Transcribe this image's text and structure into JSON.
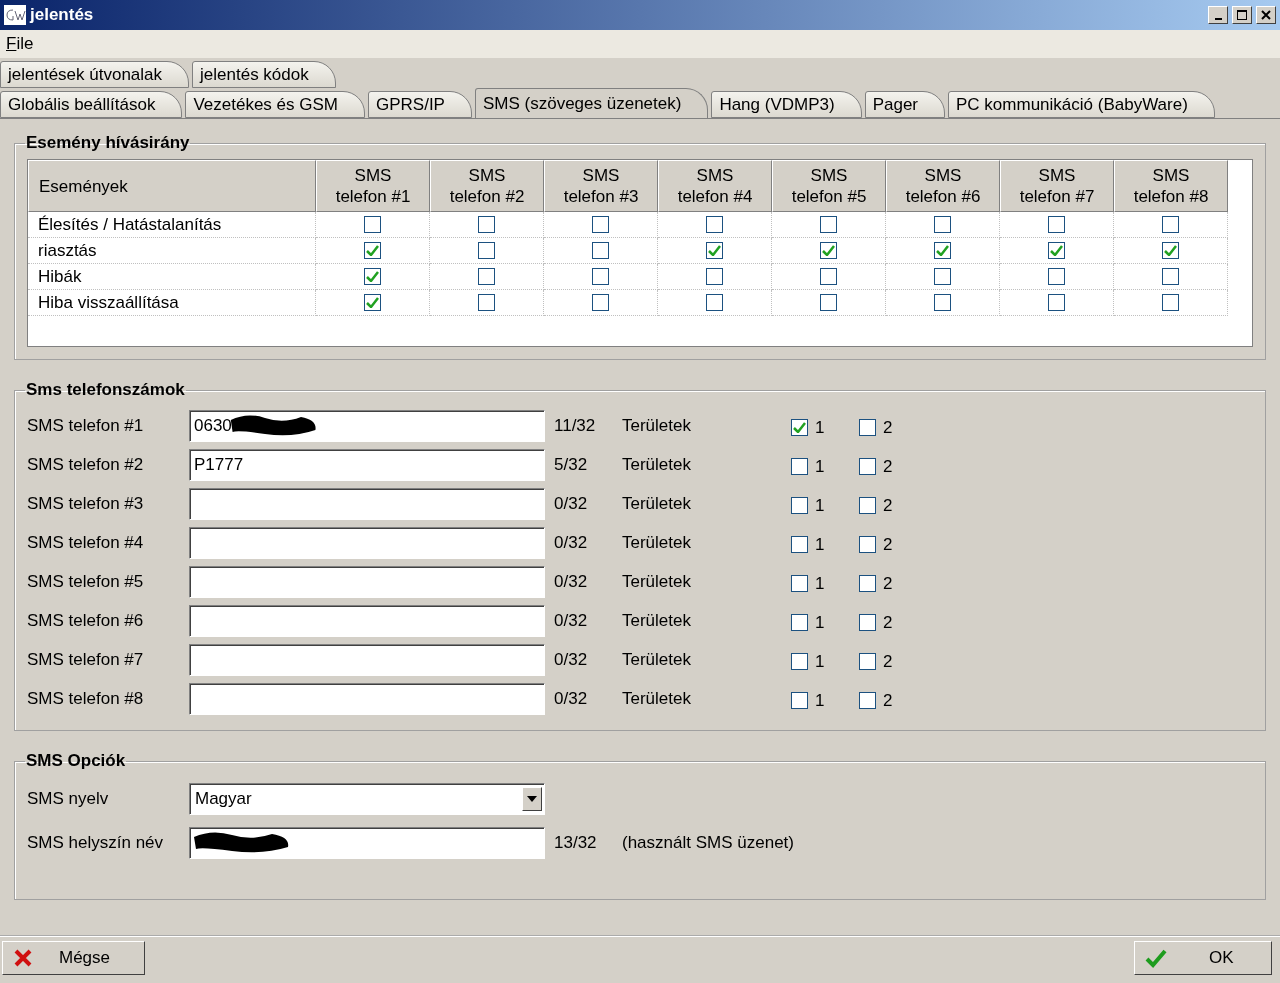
{
  "window": {
    "title": "jelentés"
  },
  "menu": [
    {
      "label": "File"
    }
  ],
  "tab_rows": [
    [
      {
        "label": "jelentések útvonalak",
        "selected": false
      },
      {
        "label": "jelentés kódok",
        "selected": false
      }
    ],
    [
      {
        "label": "Globális beállítások",
        "selected": false
      },
      {
        "label": "Vezetékes és GSM",
        "selected": false
      },
      {
        "label": "GPRS/IP",
        "selected": false
      },
      {
        "label": "SMS (szöveges üzenetek)",
        "selected": true
      },
      {
        "label": "Hang (VDMP3)",
        "selected": false
      },
      {
        "label": "Pager",
        "selected": false
      },
      {
        "label": "PC kommunikáció (BabyWare)",
        "selected": false
      }
    ]
  ],
  "event_routing": {
    "title": "Esemény hívásirány",
    "first_column": "Események",
    "columns": [
      [
        "SMS",
        "telefon #1"
      ],
      [
        "SMS",
        "telefon #2"
      ],
      [
        "SMS",
        "telefon #3"
      ],
      [
        "SMS",
        "telefon #4"
      ],
      [
        "SMS",
        "telefon #5"
      ],
      [
        "SMS",
        "telefon #6"
      ],
      [
        "SMS",
        "telefon #7"
      ],
      [
        "SMS",
        "telefon #8"
      ]
    ],
    "rows": [
      {
        "event": "Élesítés / Hatástalanítás",
        "checked": [
          false,
          false,
          false,
          false,
          false,
          false,
          false,
          false
        ]
      },
      {
        "event": "riasztás",
        "checked": [
          true,
          false,
          false,
          true,
          true,
          true,
          true,
          true
        ]
      },
      {
        "event": "Hibák",
        "checked": [
          true,
          false,
          false,
          false,
          false,
          false,
          false,
          false
        ]
      },
      {
        "event": "Hiba visszaállítása",
        "checked": [
          true,
          false,
          false,
          false,
          false,
          false,
          false,
          false
        ]
      }
    ]
  },
  "phones": {
    "title": "Sms telefonszámok",
    "items": [
      {
        "label": "SMS telefon #1",
        "value": "0630",
        "redacted": true,
        "count": "11/32",
        "areas_label": "Területek",
        "areas": [
          {
            "label": "1",
            "checked": true
          },
          {
            "label": "2",
            "checked": false
          }
        ]
      },
      {
        "label": "SMS telefon #2",
        "value": "P1777",
        "redacted": false,
        "count": "5/32",
        "areas_label": "Területek",
        "areas": [
          {
            "label": "1",
            "checked": false
          },
          {
            "label": "2",
            "checked": false
          }
        ]
      },
      {
        "label": "SMS telefon #3",
        "redacted": false,
        "count": "0/32",
        "areas_label": "Területek",
        "areas": [
          {
            "label": "1",
            "checked": false
          },
          {
            "label": "2",
            "checked": false
          }
        ]
      },
      {
        "label": "SMS telefon #4",
        "redacted": false,
        "count": "0/32",
        "areas_label": "Területek",
        "areas": [
          {
            "label": "1",
            "checked": false
          },
          {
            "label": "2",
            "checked": false
          }
        ]
      },
      {
        "label": "SMS telefon #5",
        "redacted": false,
        "count": "0/32",
        "areas_label": "Területek",
        "areas": [
          {
            "label": "1",
            "checked": false
          },
          {
            "label": "2",
            "checked": false
          }
        ]
      },
      {
        "label": "SMS telefon #6",
        "redacted": false,
        "count": "0/32",
        "areas_label": "Területek",
        "areas": [
          {
            "label": "1",
            "checked": false
          },
          {
            "label": "2",
            "checked": false
          }
        ]
      },
      {
        "label": "SMS telefon #7",
        "redacted": false,
        "count": "0/32",
        "areas_label": "Területek",
        "areas": [
          {
            "label": "1",
            "checked": false
          },
          {
            "label": "2",
            "checked": false
          }
        ]
      },
      {
        "label": "SMS telefon #8",
        "redacted": false,
        "count": "0/32",
        "areas_label": "Területek",
        "areas": [
          {
            "label": "1",
            "checked": false
          },
          {
            "label": "2",
            "checked": false
          }
        ]
      }
    ]
  },
  "options": {
    "title": "SMS Opciók",
    "language_label": "SMS nyelv",
    "language": "Magyar",
    "location_label": "SMS helyszín név",
    "location_redacted": true,
    "location_count": "13/32",
    "location_note": "(használt SMS üzenet)"
  },
  "buttons": [
    {
      "kind": "cancel",
      "label": "Mégse"
    },
    {
      "kind": "ok",
      "label": "OK"
    }
  ]
}
